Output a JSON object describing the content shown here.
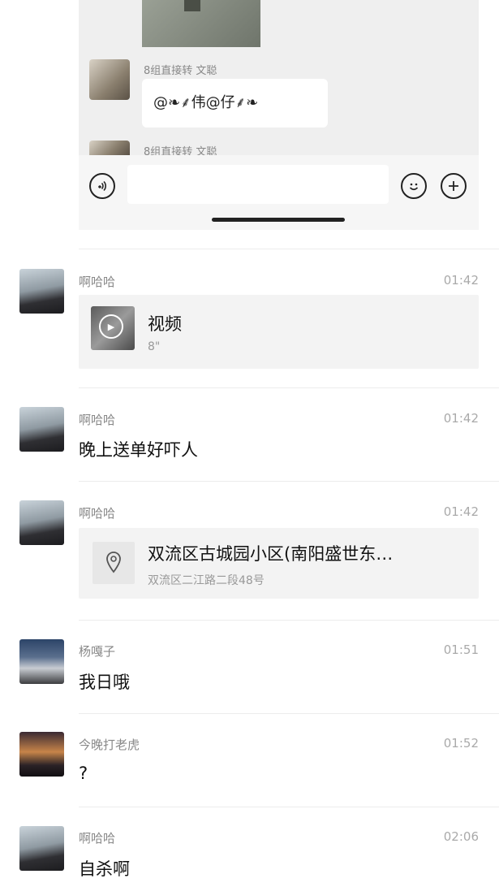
{
  "embedded_chat": {
    "messages": [
      {
        "sender": "8组直接转 文聪",
        "text": "@❧⸙伟@仔⸙❧"
      },
      {
        "sender": "8组直接转 文聪"
      }
    ]
  },
  "feed": [
    {
      "sender": "啊哈哈",
      "time": "01:42",
      "type": "video",
      "title": "视频",
      "duration": "8\""
    },
    {
      "sender": "啊哈哈",
      "time": "01:42",
      "type": "text",
      "text": "晚上送单好吓人"
    },
    {
      "sender": "啊哈哈",
      "time": "01:42",
      "type": "location",
      "title": "双流区古城园小区(南阳盛世东…",
      "address": "双流区二江路二段48号"
    },
    {
      "sender": "杨嘎子",
      "time": "01:51",
      "type": "text",
      "text": "我日哦"
    },
    {
      "sender": "今晚打老虎",
      "time": "01:52",
      "type": "text",
      "text": "?"
    },
    {
      "sender": "啊哈哈",
      "time": "02:06",
      "type": "text",
      "text": "自杀啊"
    }
  ]
}
